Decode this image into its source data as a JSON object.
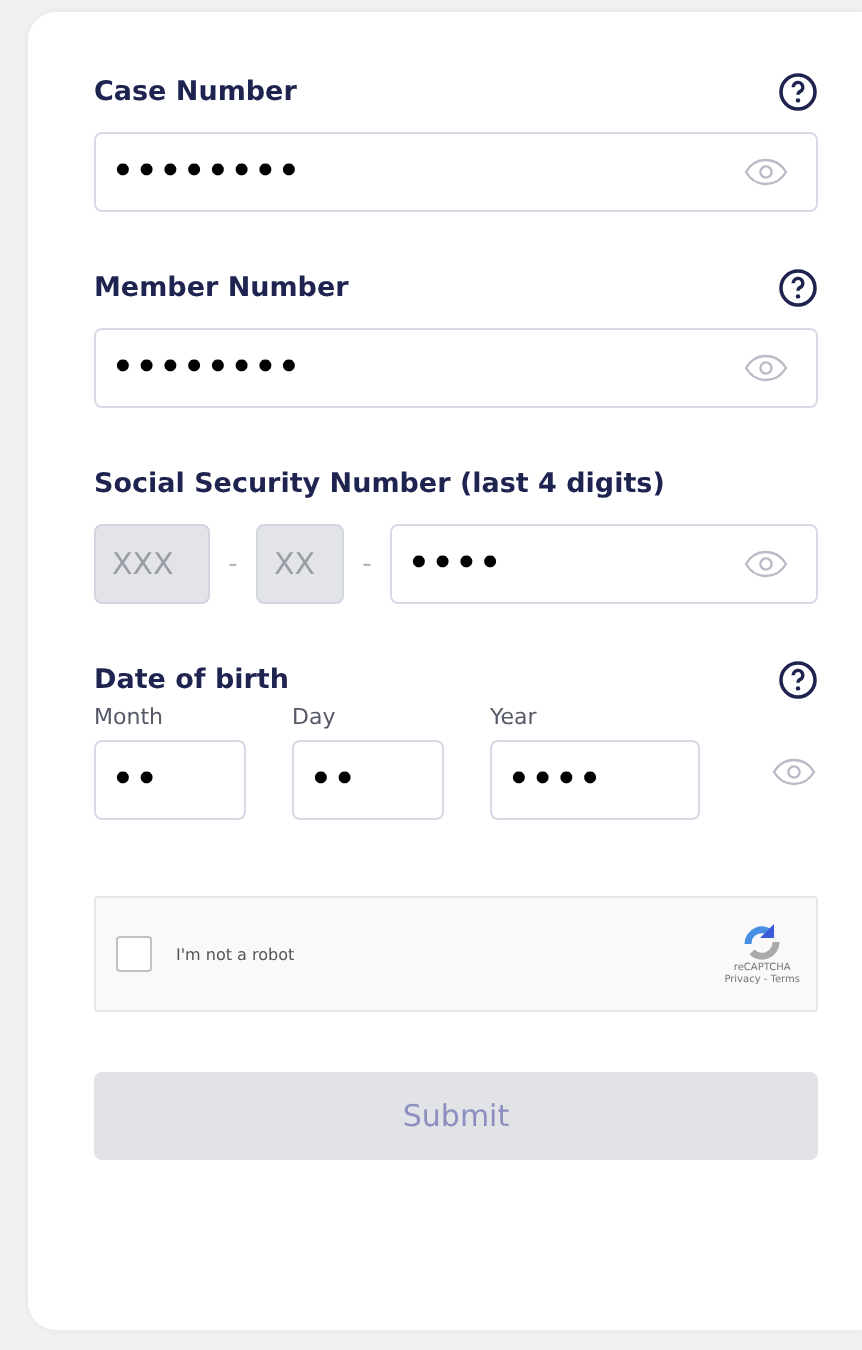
{
  "fields": [
    {
      "label": "Case Number",
      "help": true,
      "value": "••••••••",
      "reveal": true
    },
    {
      "label": "Member Number",
      "help": true,
      "value": "••••••••",
      "reveal": true
    }
  ],
  "ssn": {
    "label": "Social Security Number (last 4 digits)",
    "help": false,
    "parts": [
      {
        "placeholder": "XXX",
        "disabled": true,
        "separator": "-"
      },
      {
        "placeholder": "XX",
        "disabled": true,
        "separator": "-"
      },
      {
        "value": "••••",
        "disabled": false,
        "reveal": true
      }
    ]
  },
  "dob": {
    "label": "Date of birth",
    "help": true,
    "reveal": true,
    "parts": [
      {
        "sublabel": "Month",
        "value": "••"
      },
      {
        "sublabel": "Day",
        "value": "••"
      },
      {
        "sublabel": "Year",
        "value": "••••"
      }
    ]
  },
  "captcha": {
    "label": "I'm not a robot",
    "checked": false,
    "brand": "reCAPTCHA",
    "links": "Privacy - Terms"
  },
  "submit": {
    "label": "Submit",
    "disabled": true
  }
}
